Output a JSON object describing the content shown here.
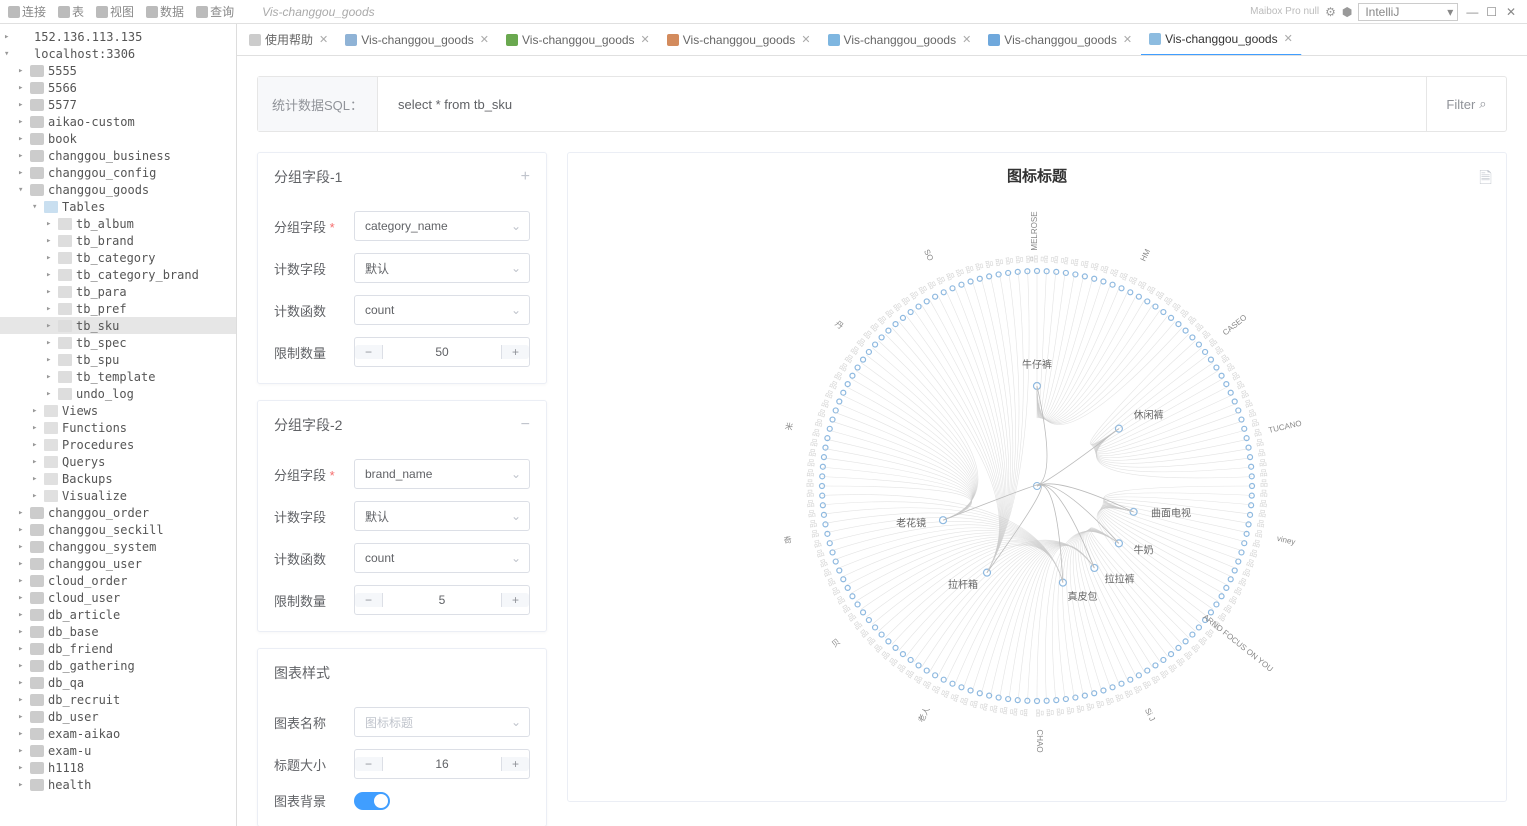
{
  "menubar": {
    "items": [
      "连接",
      "表",
      "视图",
      "数据",
      "查询"
    ],
    "breadcrumb": "Vis-changgou_goods",
    "right_text": "Maibox Pro null",
    "dropdown": "IntelliJ"
  },
  "tree": {
    "conns": [
      {
        "name": "152.136.113.135",
        "expanded": false
      },
      {
        "name": "localhost:3306",
        "expanded": true,
        "children": [
          {
            "name": "5555",
            "type": "db"
          },
          {
            "name": "5566",
            "type": "db"
          },
          {
            "name": "5577",
            "type": "db"
          },
          {
            "name": "aikao-custom",
            "type": "db"
          },
          {
            "name": "book",
            "type": "db"
          },
          {
            "name": "changgou_business",
            "type": "db"
          },
          {
            "name": "changgou_config",
            "type": "db"
          },
          {
            "name": "changgou_goods",
            "type": "db",
            "expanded": true,
            "children": [
              {
                "name": "Tables",
                "type": "folder",
                "expanded": true,
                "children": [
                  {
                    "name": "tb_album",
                    "type": "table"
                  },
                  {
                    "name": "tb_brand",
                    "type": "table"
                  },
                  {
                    "name": "tb_category",
                    "type": "table"
                  },
                  {
                    "name": "tb_category_brand",
                    "type": "table"
                  },
                  {
                    "name": "tb_para",
                    "type": "table"
                  },
                  {
                    "name": "tb_pref",
                    "type": "table"
                  },
                  {
                    "name": "tb_sku",
                    "type": "table",
                    "selected": true
                  },
                  {
                    "name": "tb_spec",
                    "type": "table"
                  },
                  {
                    "name": "tb_spu",
                    "type": "table"
                  },
                  {
                    "name": "tb_template",
                    "type": "table"
                  },
                  {
                    "name": "undo_log",
                    "type": "table"
                  }
                ]
              },
              {
                "name": "Views",
                "type": "misc"
              },
              {
                "name": "Functions",
                "type": "misc"
              },
              {
                "name": "Procedures",
                "type": "misc"
              },
              {
                "name": "Querys",
                "type": "misc"
              },
              {
                "name": "Backups",
                "type": "misc"
              },
              {
                "name": "Visualize",
                "type": "misc"
              }
            ]
          },
          {
            "name": "changgou_order",
            "type": "db"
          },
          {
            "name": "changgou_seckill",
            "type": "db"
          },
          {
            "name": "changgou_system",
            "type": "db"
          },
          {
            "name": "changgou_user",
            "type": "db"
          },
          {
            "name": "cloud_order",
            "type": "db"
          },
          {
            "name": "cloud_user",
            "type": "db"
          },
          {
            "name": "db_article",
            "type": "db"
          },
          {
            "name": "db_base",
            "type": "db"
          },
          {
            "name": "db_friend",
            "type": "db"
          },
          {
            "name": "db_gathering",
            "type": "db"
          },
          {
            "name": "db_qa",
            "type": "db"
          },
          {
            "name": "db_recruit",
            "type": "db"
          },
          {
            "name": "db_user",
            "type": "db"
          },
          {
            "name": "exam-aikao",
            "type": "db"
          },
          {
            "name": "exam-u",
            "type": "db"
          },
          {
            "name": "h1118",
            "type": "db"
          },
          {
            "name": "health",
            "type": "db"
          }
        ]
      }
    ]
  },
  "tabs": [
    {
      "label": "使用帮助",
      "icon": "#ccc",
      "active": false,
      "closable": true
    },
    {
      "label": "Vis-changgou_goods",
      "icon": "#8fb3d6",
      "active": false,
      "closable": true
    },
    {
      "label": "Vis-changgou_goods",
      "icon": "#6aa84f",
      "active": false,
      "closable": true
    },
    {
      "label": "Vis-changgou_goods",
      "icon": "#d38b5d",
      "active": false,
      "closable": true
    },
    {
      "label": "Vis-changgou_goods",
      "icon": "#7eb6e0",
      "active": false,
      "closable": true
    },
    {
      "label": "Vis-changgou_goods",
      "icon": "#6fa8dc",
      "active": false,
      "closable": true
    },
    {
      "label": "Vis-changgou_goods",
      "icon": "#8dbce0",
      "active": true,
      "closable": true
    }
  ],
  "sqlbar": {
    "label": "统计数据SQL：",
    "sql": "select * from tb_sku",
    "filter": "Filter"
  },
  "group1": {
    "title": "分组字段-1",
    "toggle": "+",
    "field_label": "分组字段",
    "field_value": "category_name",
    "count_field_label": "计数字段",
    "count_field_value": "默认",
    "count_func_label": "计数函数",
    "count_func_value": "count",
    "limit_label": "限制数量",
    "limit_value": "50"
  },
  "group2": {
    "title": "分组字段-2",
    "toggle": "−",
    "field_label": "分组字段",
    "field_value": "brand_name",
    "count_field_label": "计数字段",
    "count_field_value": "默认",
    "count_func_label": "计数函数",
    "count_func_value": "count",
    "limit_label": "限制数量",
    "limit_value": "5"
  },
  "style": {
    "title": "图表样式",
    "name_label": "图表名称",
    "name_value": "图标标题",
    "title_size_label": "标题大小",
    "title_size_value": "16",
    "bg_label": "图表背景"
  },
  "chart": {
    "title": "图标标题",
    "inner_labels": [
      "牛仔裤",
      "休闲裤",
      "曲面电视",
      "牛奶",
      "拉拉裤",
      "真皮包",
      "老花镜",
      "拉杆箱"
    ],
    "outer_labels": [
      "MELROSE",
      "HM",
      "CASEO",
      "TUCANO",
      "viney",
      "ARNO FOCUS ON YOU",
      "Si J",
      "CHAO",
      "老人",
      "贝",
      "奇",
      "米",
      "丹",
      "SO"
    ]
  }
}
